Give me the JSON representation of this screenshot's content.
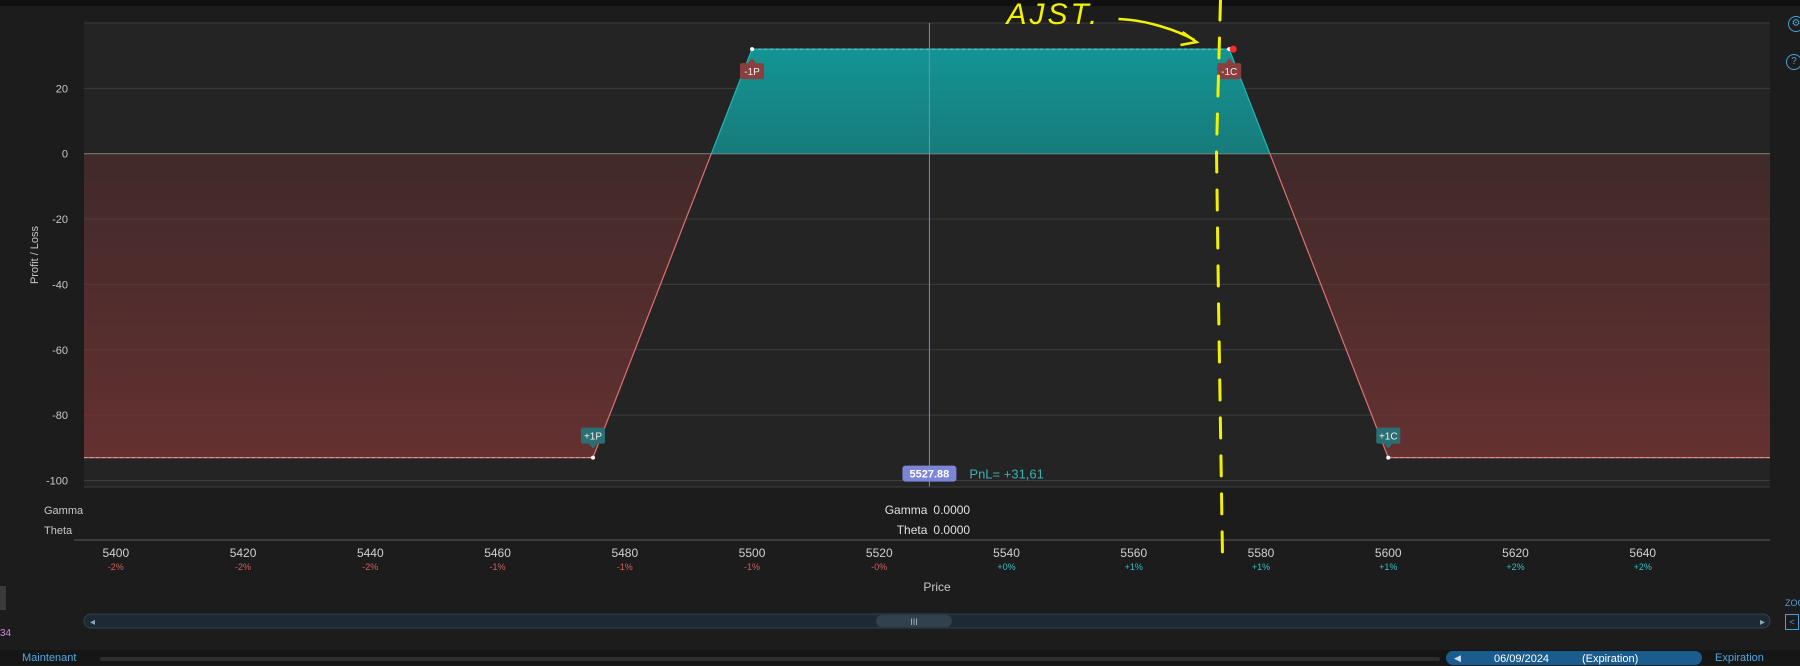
{
  "chart_data": {
    "type": "line",
    "xlabel": "Price",
    "ylabel": "Profit / Loss",
    "xlim": [
      5395,
      5660
    ],
    "ylim": [
      -102,
      40
    ],
    "x_ticks": [
      5400,
      5420,
      5440,
      5460,
      5480,
      5500,
      5520,
      5540,
      5560,
      5580,
      5600,
      5620,
      5640
    ],
    "x_pct_labels": [
      "-2%",
      "-2%",
      "-2%",
      "-1%",
      "-1%",
      "-1%",
      "-0%",
      "+0%",
      "+1%",
      "+1%",
      "+1%",
      "+2%",
      "+2%"
    ],
    "y_ticks": [
      20,
      0,
      -20,
      -40,
      -60,
      -80,
      -100
    ],
    "payoff": {
      "x": [
        5395,
        5475,
        5500,
        5575,
        5600,
        5660
      ],
      "y": [
        -93,
        -93,
        32,
        32,
        -93,
        -93
      ]
    },
    "legs": [
      {
        "label": "-1P",
        "x": 5500,
        "y": 32
      },
      {
        "label": "-1C",
        "x": 5575,
        "y": 32
      },
      {
        "label": "+1P",
        "x": 5475,
        "y": -93
      },
      {
        "label": "+1C",
        "x": 5600,
        "y": -93
      }
    ],
    "current_price": 5527.88,
    "current_price_label": "5527.88",
    "pnl_label": "PnL= +31,61",
    "greeks": [
      {
        "name": "Gamma",
        "value": "0.0000"
      },
      {
        "name": "Theta",
        "value": "0.0000"
      }
    ],
    "annotation": {
      "text": "AJST.",
      "x": 5573,
      "color": "#f2f200"
    },
    "colors": {
      "profit_fill": "#139a9a",
      "loss_fill": "#7a3535",
      "profit_line": "#22b5b5",
      "loss_line": "#e07070",
      "price_line": "#7c85d6",
      "price_badge": "#7c85d6",
      "leg_short": "#8a3f3f",
      "leg_long": "#2a6f73",
      "pnl_text": "#33b3b3",
      "pct_negative": "#d06060",
      "pct_positive": "#33c2c2"
    }
  },
  "footer": {
    "left_label": "Maintenant",
    "date": "06/09/2024",
    "date_suffix": "(Expiration)",
    "right_label": "Expiration",
    "left_value": "34",
    "zoom_label": "ZOO",
    "scroll_handle": "III"
  },
  "side_icons": {
    "settings": "gear-icon",
    "help": "?"
  }
}
